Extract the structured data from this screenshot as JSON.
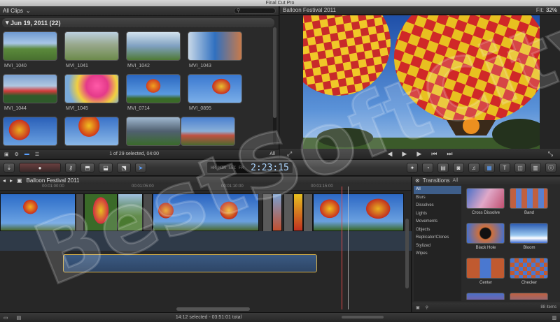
{
  "app": {
    "title": "Final Cut Pro"
  },
  "browser": {
    "library_label": "All Clips",
    "event_title": "Jun 19, 2011  (22)",
    "clips": [
      {
        "name": "MVI_1040"
      },
      {
        "name": "MVI_1041"
      },
      {
        "name": "MVI_1042"
      },
      {
        "name": "MVI_1043"
      },
      {
        "name": "MVI_1044"
      },
      {
        "name": "MVI_1045"
      },
      {
        "name": "MVI_0714"
      },
      {
        "name": "MVI_0895"
      },
      {
        "name": ""
      },
      {
        "name": ""
      },
      {
        "name": ""
      },
      {
        "name": ""
      }
    ],
    "footer_status": "1 of 29 selected, 04:00",
    "footer_filter": "All"
  },
  "viewer": {
    "title": "Balloon Festival 2011",
    "fit_label": "Fit:",
    "fit_value": "32%"
  },
  "toolbar": {
    "timecode": "2:23:15",
    "timecode_prefix": "HR  MIN  SEC  FR"
  },
  "timeline": {
    "project_title": "Balloon Festival 2011",
    "ruler_marks": [
      "00:01:00:00",
      "00:01:05:00",
      "00:01:10:00",
      "00:01:15:00"
    ]
  },
  "transitions": {
    "title": "Transitions",
    "filter_label": "All",
    "categories": [
      "All",
      "Blurs",
      "Dissolves",
      "Lights",
      "Movements",
      "Objects",
      "Replicator/Clones",
      "Stylized",
      "Wipes"
    ],
    "items": [
      {
        "name": "Cross Dissolve"
      },
      {
        "name": "Band"
      },
      {
        "name": "Black Hole"
      },
      {
        "name": "Bloom"
      },
      {
        "name": "Center"
      },
      {
        "name": "Checker"
      }
    ],
    "count": "88 items"
  },
  "status": {
    "selection": "14:12 selected - 03:51:01 total"
  },
  "watermark": {
    "text": "BestSoftCity"
  },
  "colors": {
    "accent": "#3e5e8a",
    "playhead": "#e04848",
    "timecode": "#9fd0ff"
  }
}
